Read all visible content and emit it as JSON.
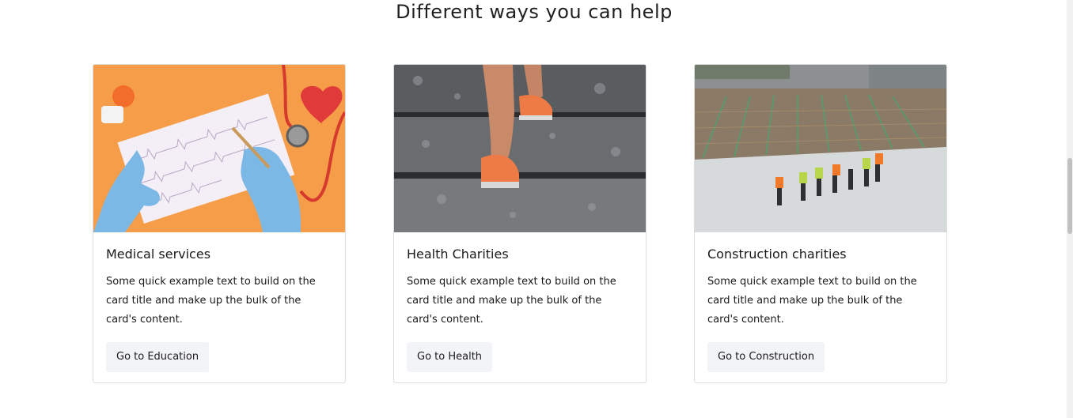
{
  "section": {
    "title": "Different ways you can help"
  },
  "cards": [
    {
      "title": "Medical services",
      "text": "Some quick example text to build on the card title and make up the bulk of the card's content.",
      "button": "Go to Education",
      "image_alt": "Gloved hands writing on an ECG chart with stethoscope and heart"
    },
    {
      "title": "Health Charities",
      "text": "Some quick example text to build on the card title and make up the bulk of the card's content.",
      "button": "Go to Health",
      "image_alt": "Runner climbing concrete stairs"
    },
    {
      "title": "Construction charities",
      "text": "Some quick example text to build on the card title and make up the bulk of the card's content.",
      "button": "Go to Construction",
      "image_alt": "Construction workers overlooking a building site"
    }
  ]
}
